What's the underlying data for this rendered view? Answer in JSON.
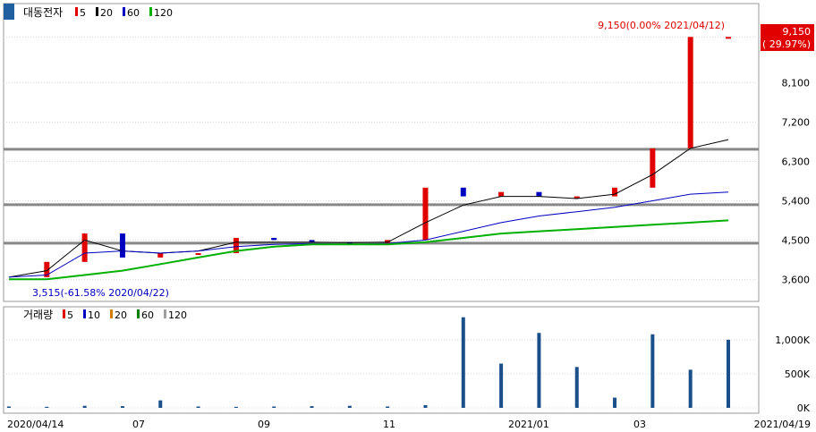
{
  "chart_data": [
    {
      "type": "candlestick",
      "title": "대동전자",
      "legend": [
        {
          "label": "5",
          "color": "#e00000"
        },
        {
          "label": "20",
          "color": "#000000"
        },
        {
          "label": "60",
          "color": "#0000c0"
        },
        {
          "label": "120",
          "color": "#00b000"
        }
      ],
      "y_ticks": [
        "9,150",
        "8,100",
        "7,200",
        "6,300",
        "5,400",
        "4,500",
        "3,600"
      ],
      "ylim": [
        3300,
        9300
      ],
      "price_max_annotation": "9,150(0.00% 2021/04/12)",
      "price_min_annotation": "3,515(-61.58% 2020/04/22)",
      "current_price": "9,150",
      "current_change": "( 29.97%)",
      "horizontal_lines": [
        6580,
        5310,
        4430
      ],
      "series": [
        {
          "name": "close",
          "x": [
            "2020/04/14",
            "2020/05/15",
            "2020/06/15",
            "2020/07/15",
            "2020/08/14",
            "2020/09/14",
            "2020/10/15",
            "2020/11/16",
            "2020/12/15",
            "2021/01/05",
            "2021/01/15",
            "2021/01/26",
            "2021/02/05",
            "2021/02/17",
            "2021/03/03",
            "2021/03/17",
            "2021/03/31",
            "2021/04/08",
            "2021/04/12",
            "2021/04/19"
          ],
          "values": [
            3650,
            4000,
            4650,
            4100,
            4200,
            4200,
            4550,
            4500,
            4450,
            4430,
            4500,
            5700,
            5500,
            5600,
            5500,
            5500,
            5700,
            6600,
            9150,
            9150
          ]
        },
        {
          "name": "20",
          "values": [
            3650,
            3800,
            4500,
            4250,
            4200,
            4250,
            4450,
            4450,
            4450,
            4440,
            4450,
            4900,
            5300,
            5500,
            5500,
            5450,
            5550,
            6000,
            6600,
            6800
          ]
        },
        {
          "name": "60",
          "values": [
            3650,
            3700,
            4200,
            4250,
            4200,
            4250,
            4350,
            4400,
            4420,
            4400,
            4420,
            4500,
            4700,
            4900,
            5050,
            5150,
            5250,
            5400,
            5550,
            5600
          ]
        },
        {
          "name": "120",
          "values": [
            3600,
            3600,
            3700,
            3800,
            3950,
            4100,
            4250,
            4350,
            4400,
            4400,
            4400,
            4450,
            4550,
            4650,
            4700,
            4750,
            4800,
            4850,
            4900,
            4950
          ]
        }
      ]
    },
    {
      "type": "bar",
      "title": "거래량",
      "legend": [
        {
          "label": "5",
          "color": "#e00000"
        },
        {
          "label": "10",
          "color": "#0000c0"
        },
        {
          "label": "20",
          "color": "#d08000"
        },
        {
          "label": "60",
          "color": "#008000"
        },
        {
          "label": "120",
          "color": "#a0a0a0"
        }
      ],
      "y_ticks": [
        "1,000K",
        "500K",
        "0K"
      ],
      "ylim": [
        0,
        1300
      ],
      "x_ticks": [
        "2020/04/14",
        "07",
        "09",
        "11",
        "2021/01",
        "03",
        "2021/04/19"
      ],
      "volume_k": [
        20,
        15,
        30,
        25,
        110,
        20,
        15,
        20,
        25,
        30,
        20,
        40,
        1330,
        650,
        1100,
        600,
        150,
        1080,
        560,
        1000
      ]
    }
  ]
}
